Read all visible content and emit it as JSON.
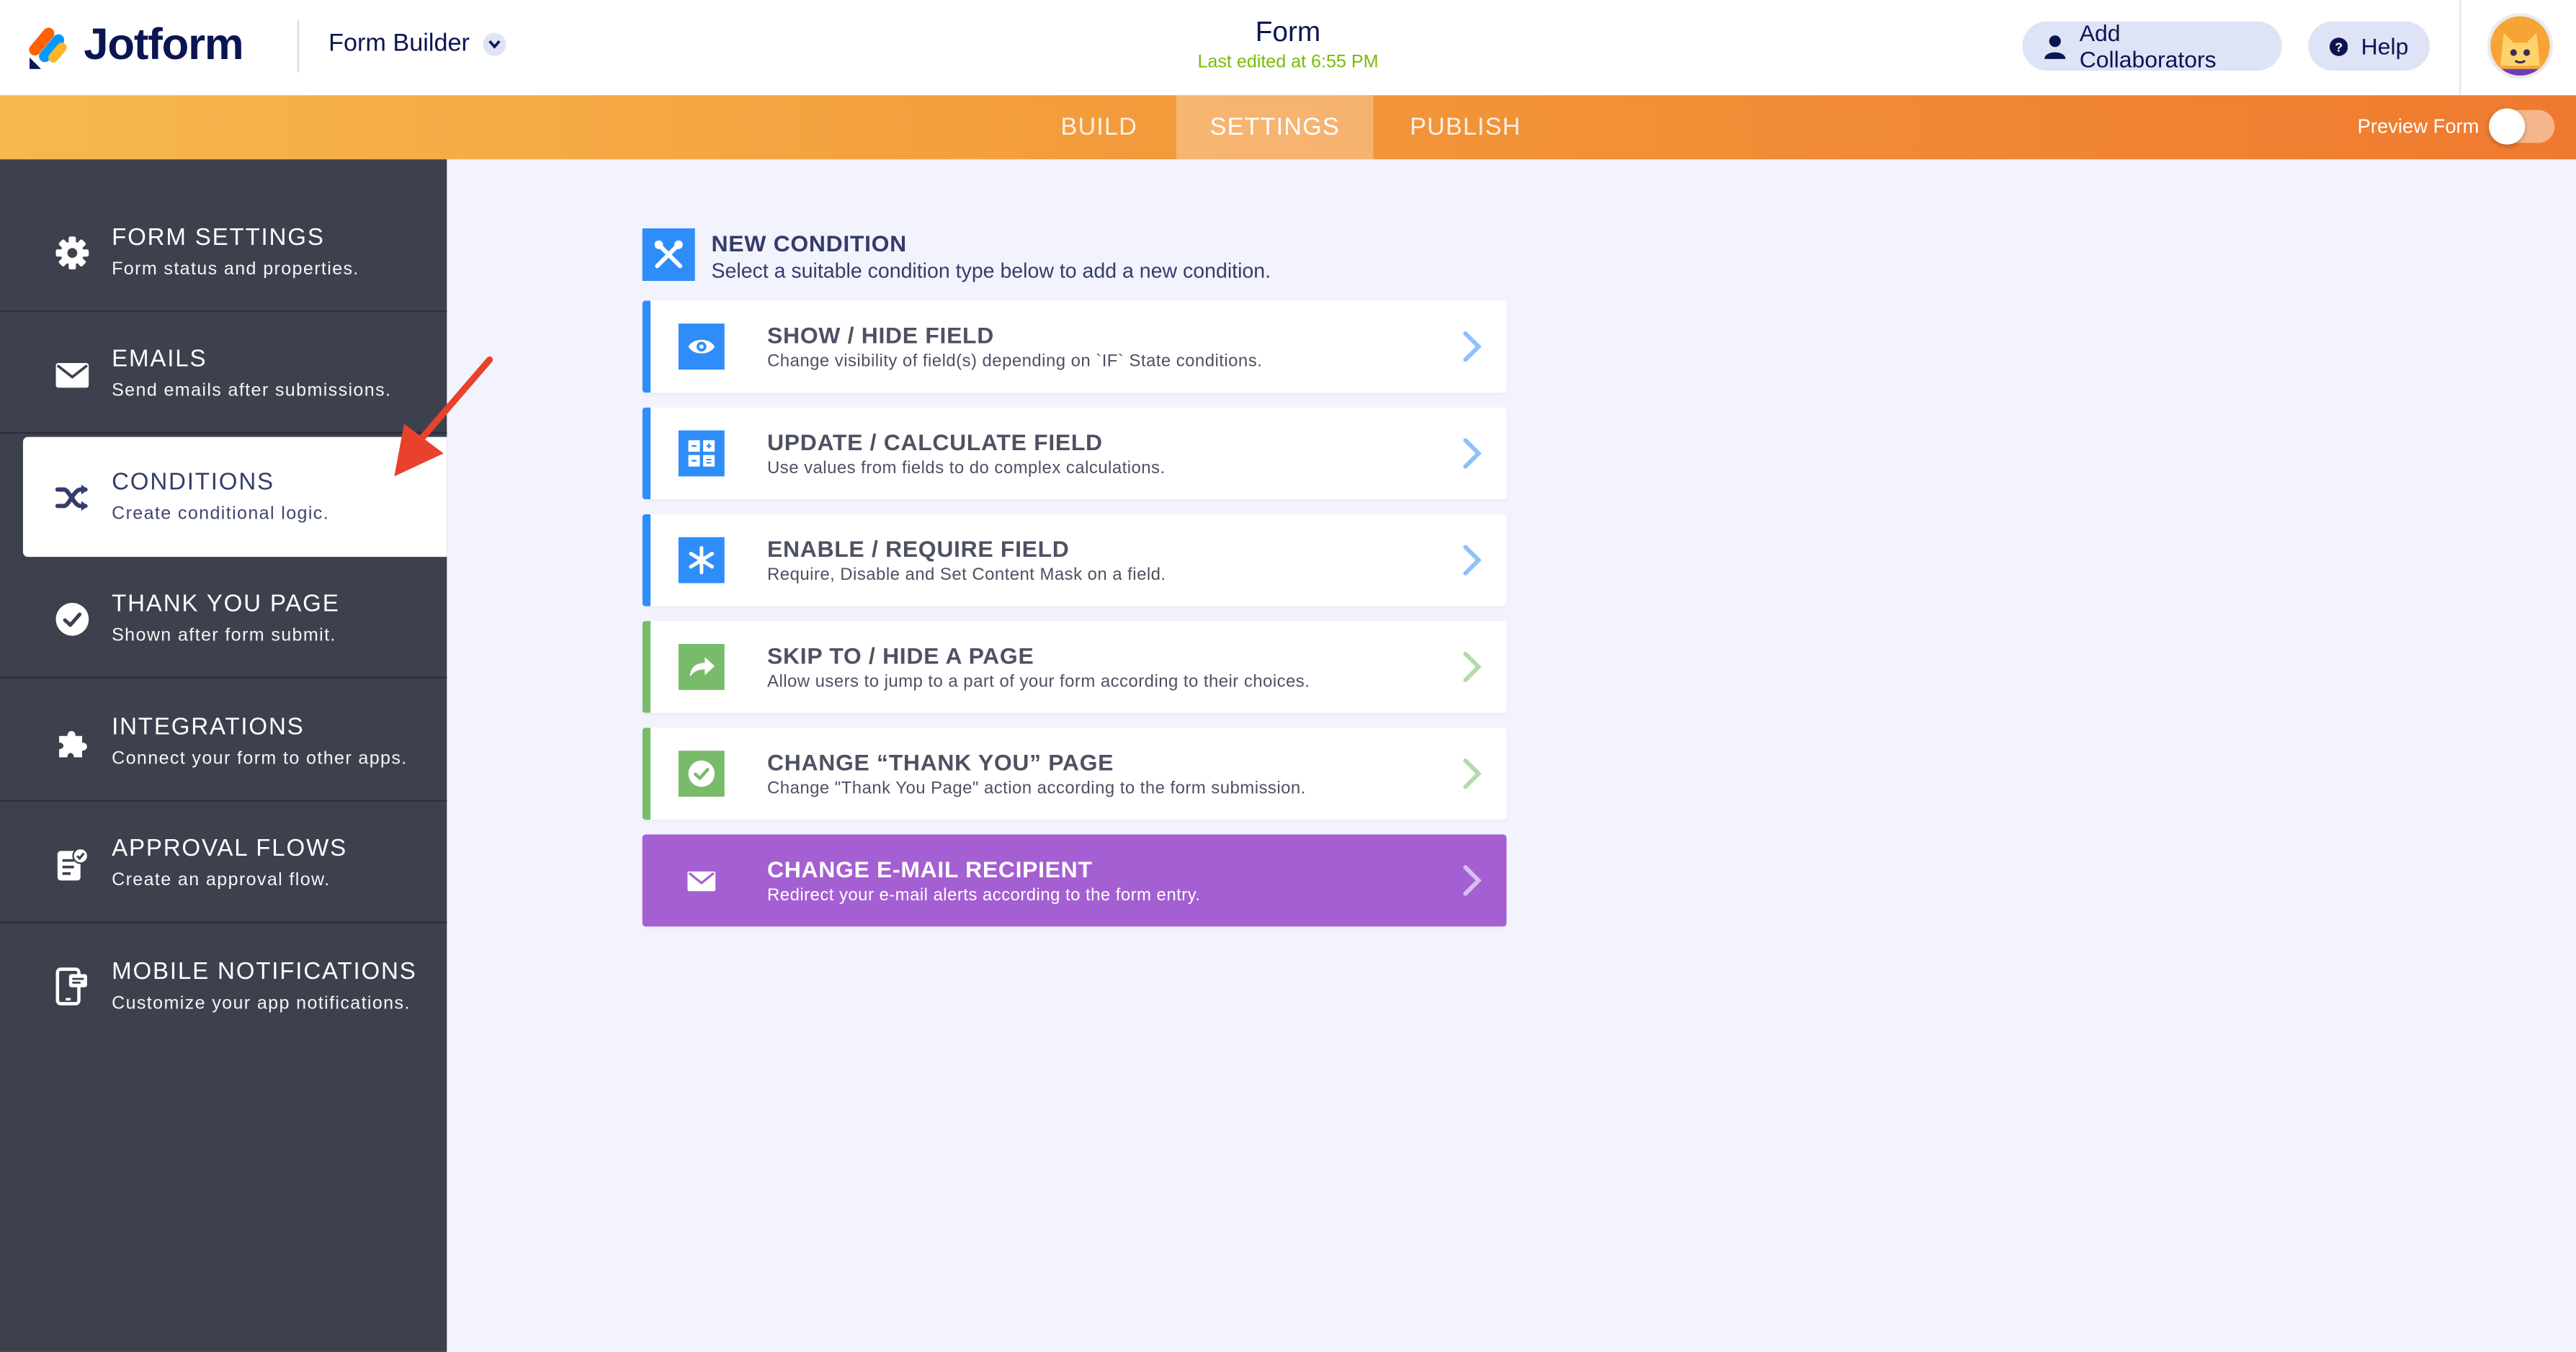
{
  "header": {
    "brand": "Jotform",
    "builder_label": "Form Builder",
    "form_title": "Form",
    "last_edited": "Last edited at 6:55 PM",
    "add_collaborators": "Add Collaborators",
    "help": "Help"
  },
  "nav": {
    "tabs": [
      {
        "label": "BUILD",
        "active": false
      },
      {
        "label": "SETTINGS",
        "active": true
      },
      {
        "label": "PUBLISH",
        "active": false
      }
    ],
    "preview_label": "Preview Form",
    "preview_on": false
  },
  "sidebar": {
    "items": [
      {
        "title": "FORM SETTINGS",
        "subtitle": "Form status and properties.",
        "icon": "gear-icon"
      },
      {
        "title": "EMAILS",
        "subtitle": "Send emails after submissions.",
        "icon": "envelope-icon"
      },
      {
        "title": "CONDITIONS",
        "subtitle": "Create conditional logic.",
        "icon": "shuffle-icon",
        "active": true
      },
      {
        "title": "THANK YOU PAGE",
        "subtitle": "Shown after form submit.",
        "icon": "check-circle-icon"
      },
      {
        "title": "INTEGRATIONS",
        "subtitle": "Connect your form to other apps.",
        "icon": "puzzle-icon"
      },
      {
        "title": "APPROVAL FLOWS",
        "subtitle": "Create an approval flow.",
        "icon": "approval-icon"
      },
      {
        "title": "MOBILE NOTIFICATIONS",
        "subtitle": "Customize your app notifications.",
        "icon": "mobile-icon"
      }
    ]
  },
  "main": {
    "new_condition_title": "NEW CONDITION",
    "new_condition_subtitle": "Select a suitable condition type below to add a new condition.",
    "conditions": [
      {
        "title": "SHOW / HIDE FIELD",
        "subtitle": "Change visibility of field(s) depending on `IF` State conditions.",
        "icon": "eye-icon",
        "color": "#2f8dfa"
      },
      {
        "title": "UPDATE / CALCULATE FIELD",
        "subtitle": "Use values from fields to do complex calculations.",
        "icon": "calculator-icon",
        "color": "#2f8dfa"
      },
      {
        "title": "ENABLE / REQUIRE FIELD",
        "subtitle": "Require, Disable and Set Content Mask on a field.",
        "icon": "asterisk-icon",
        "color": "#2f8dfa"
      },
      {
        "title": "SKIP TO / HIDE A PAGE",
        "subtitle": "Allow users to jump to a part of your form according to their choices.",
        "icon": "share-arrow-icon",
        "color": "#78bb6b"
      },
      {
        "title": "CHANGE “THANK YOU” PAGE",
        "subtitle": "Change \"Thank You Page\" action according to the form submission.",
        "icon": "check-circle-icon",
        "color": "#78bb6b"
      },
      {
        "title": "CHANGE E-MAIL RECIPIENT",
        "subtitle": "Redirect your e-mail alerts according to the form entry.",
        "icon": "envelope-icon",
        "color": "#a45fd2"
      }
    ]
  },
  "colors": {
    "brand_navy": "#0a1551",
    "orange_start": "#f7b84f",
    "orange_end": "#ef7a2f",
    "sidebar_bg": "#3d414d",
    "blue": "#2f8dfa",
    "green": "#78bb6b",
    "purple": "#a45fd2",
    "annotation_red": "#e8412c"
  }
}
